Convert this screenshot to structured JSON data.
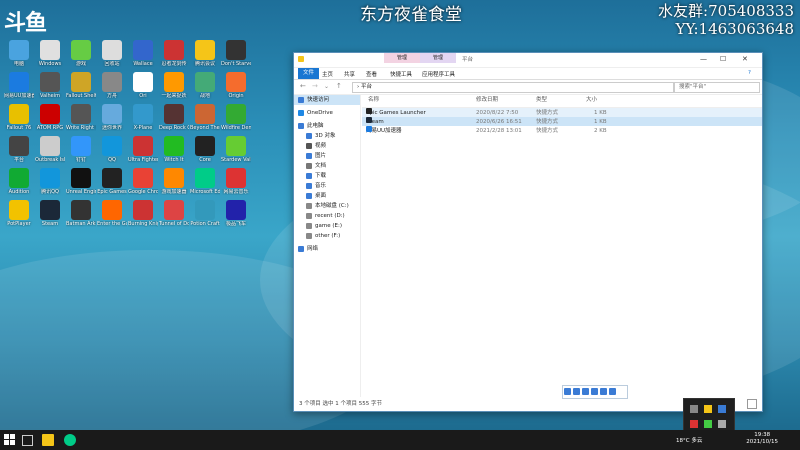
{
  "overlay": {
    "stream_title": "东方夜雀食堂",
    "qq_group": "水友群:705408333",
    "yy": "YY:1463063648",
    "logo": "斗鱼"
  },
  "desktop_icons": [
    {
      "label": "电脑",
      "color": "#4aa3df"
    },
    {
      "label": "Windows",
      "color": "#e0e0e0"
    },
    {
      "label": "游戏",
      "color": "#6c4"
    },
    {
      "label": "回收站",
      "color": "#ddd"
    },
    {
      "label": "Wallace",
      "color": "#3366cc"
    },
    {
      "label": "忍者龙剑传",
      "color": "#c33"
    },
    {
      "label": "腾讯会议",
      "color": "#f5c518"
    },
    {
      "label": "Don't Starve Together",
      "color": "#333"
    },
    {
      "label": "网易UU加速器",
      "color": "#1b7be0"
    },
    {
      "label": "Valheim",
      "color": "#555"
    },
    {
      "label": "Fallout Shelter",
      "color": "#cfa526"
    },
    {
      "label": "方舟",
      "color": "#888"
    },
    {
      "label": "Ori",
      "color": "#fff"
    },
    {
      "label": "一起来捉妖",
      "color": "#f90"
    },
    {
      "label": "战地",
      "color": "#4a7"
    },
    {
      "label": "Origin",
      "color": "#f56c2d"
    },
    {
      "label": "Fallout 76",
      "color": "#e8c000"
    },
    {
      "label": "ATOM RPG",
      "color": "#c00"
    },
    {
      "label": "Write Right Demo",
      "color": "#555"
    },
    {
      "label": "迷你世界",
      "color": "#6ad"
    },
    {
      "label": "X-Plane",
      "color": "#39c"
    },
    {
      "label": "Deep Rock Galactic",
      "color": "#533"
    },
    {
      "label": "Beyond The Storm",
      "color": "#c63"
    },
    {
      "label": "Wildfire Demo",
      "color": "#3a3"
    },
    {
      "label": "平台",
      "color": "#444"
    },
    {
      "label": "Outbreak Island",
      "color": "#ccc"
    },
    {
      "label": "钉钉",
      "color": "#3296fa"
    },
    {
      "label": "QQ",
      "color": "#1296db"
    },
    {
      "label": "Ultra Fighter",
      "color": "#c33"
    },
    {
      "label": "Witch It",
      "color": "#2b2"
    },
    {
      "label": "Core",
      "color": "#222"
    },
    {
      "label": "Stardew Valley",
      "color": "#6c3"
    },
    {
      "label": "Audition",
      "color": "#1a3"
    },
    {
      "label": "腾讯QQ",
      "color": "#1296db"
    },
    {
      "label": "Unreal Engine",
      "color": "#111"
    },
    {
      "label": "Epic Games",
      "color": "#222"
    },
    {
      "label": "Google Chrome",
      "color": "#e94235"
    },
    {
      "label": "游戏加速器",
      "color": "#ff8800"
    },
    {
      "label": "Microsoft Edge",
      "color": "#0c8"
    },
    {
      "label": "网易云音乐",
      "color": "#d33"
    },
    {
      "label": "PotPlayer",
      "color": "#f2c200"
    },
    {
      "label": "Steam",
      "color": "#1b2838"
    },
    {
      "label": "Batman Arkham",
      "color": "#333"
    },
    {
      "label": "Enter the Gungeon",
      "color": "#f60"
    },
    {
      "label": "Burning Knight",
      "color": "#c33"
    },
    {
      "label": "Tunnel of Doom",
      "color": "#d44"
    },
    {
      "label": "Potion Craft",
      "color": "#39b"
    },
    {
      "label": "极品飞车",
      "color": "#22a"
    }
  ],
  "explorer": {
    "window_title": "平台",
    "context_tabs": [
      "管理",
      "管理"
    ],
    "ribbon_tabs": [
      "文件",
      "主页",
      "共享",
      "查看",
      "快捷工具",
      "应用程序工具"
    ],
    "address_path": "› 平台",
    "search_placeholder": "搜索\"平台\"",
    "nav": [
      {
        "label": "快速访问",
        "color": "#3a7bd5",
        "sel": true
      },
      {
        "label": "OneDrive",
        "color": "#1e88e5"
      },
      {
        "label": "此电脑",
        "color": "#3a7bd5"
      },
      {
        "label": "3D 对象",
        "color": "#3a7bd5"
      },
      {
        "label": "视频",
        "color": "#555"
      },
      {
        "label": "图片",
        "color": "#3a7bd5"
      },
      {
        "label": "文档",
        "color": "#777"
      },
      {
        "label": "下载",
        "color": "#3a7bd5"
      },
      {
        "label": "音乐",
        "color": "#3a7bd5"
      },
      {
        "label": "桌面",
        "color": "#3a7bd5"
      },
      {
        "label": "本地磁盘 (C:)",
        "color": "#888"
      },
      {
        "label": "recent (D:)",
        "color": "#888"
      },
      {
        "label": "game (E:)",
        "color": "#888"
      },
      {
        "label": "other (F:)",
        "color": "#888"
      },
      {
        "label": "网络",
        "color": "#3a7bd5"
      }
    ],
    "columns": [
      "名称",
      "修改日期",
      "类型",
      "大小"
    ],
    "files": [
      {
        "name": "Epic Games Launcher",
        "date": "2020/8/22 7:50",
        "type": "快捷方式",
        "size": "1 KB",
        "color": "#222",
        "state": "hv"
      },
      {
        "name": "Steam",
        "date": "2020/6/26 16:51",
        "type": "快捷方式",
        "size": "1 KB",
        "color": "#1b2838",
        "state": "hl"
      },
      {
        "name": "网易UU加速器",
        "date": "2021/2/28 13:01",
        "type": "快捷方式",
        "size": "2 KB",
        "color": "#1b7be0",
        "state": ""
      }
    ],
    "status": "3 个项目   选中 1 个项目  555 字节"
  },
  "taskbar": {
    "weather": "18°C 多云",
    "time": "19:38",
    "date": "2021/10/15"
  }
}
